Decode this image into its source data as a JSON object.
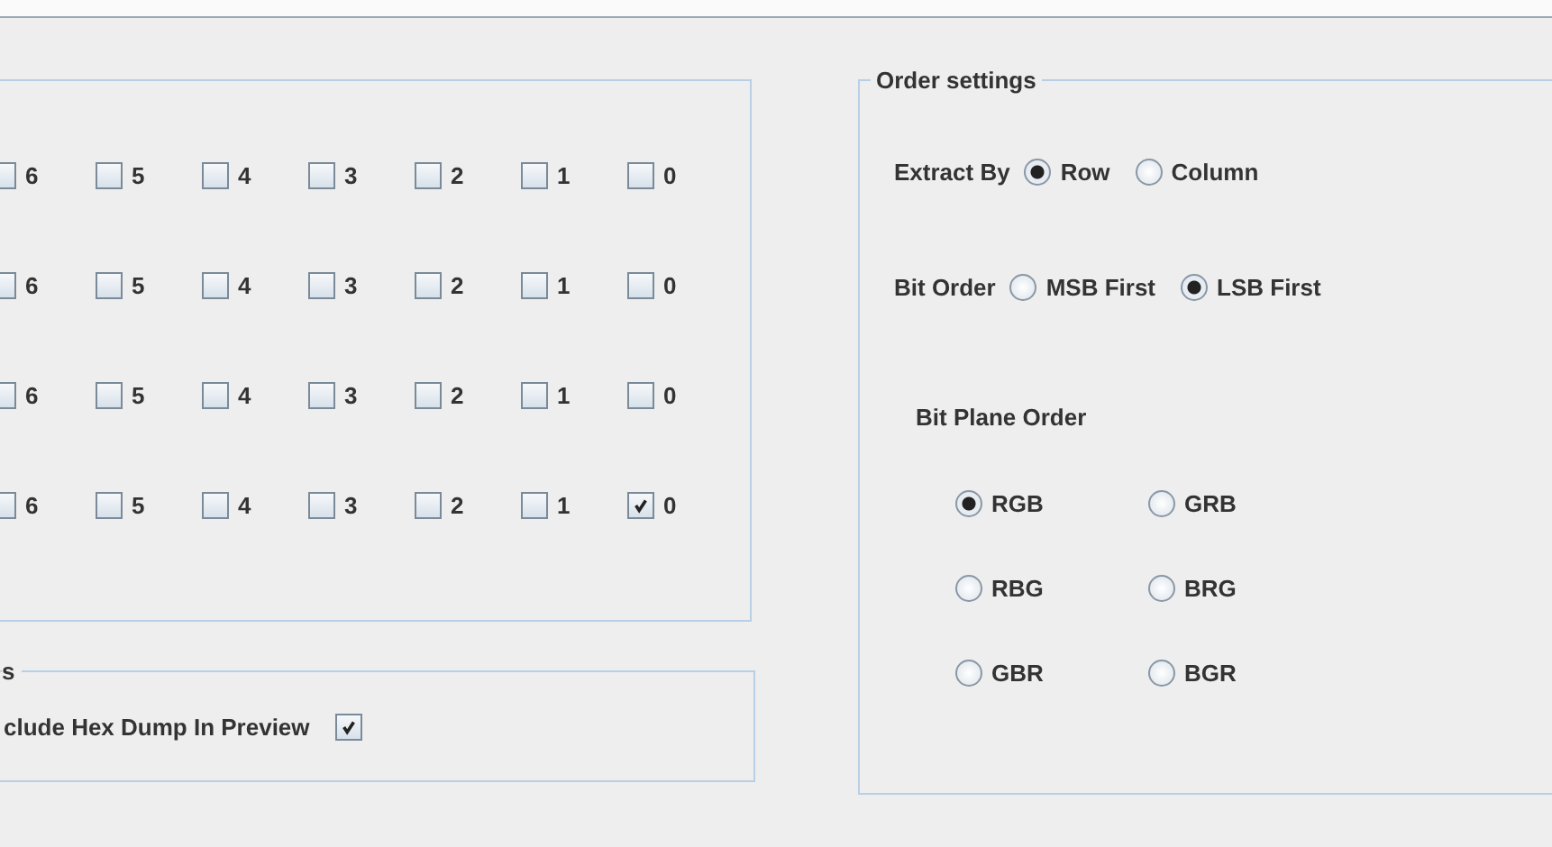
{
  "bit_panel": {
    "rows": [
      {
        "bits": [
          {
            "label": "6",
            "checked": false
          },
          {
            "label": "5",
            "checked": false
          },
          {
            "label": "4",
            "checked": false
          },
          {
            "label": "3",
            "checked": false
          },
          {
            "label": "2",
            "checked": false
          },
          {
            "label": "1",
            "checked": false
          },
          {
            "label": "0",
            "checked": false
          }
        ]
      },
      {
        "bits": [
          {
            "label": "6",
            "checked": false
          },
          {
            "label": "5",
            "checked": false
          },
          {
            "label": "4",
            "checked": false
          },
          {
            "label": "3",
            "checked": false
          },
          {
            "label": "2",
            "checked": false
          },
          {
            "label": "1",
            "checked": false
          },
          {
            "label": "0",
            "checked": false
          }
        ]
      },
      {
        "bits": [
          {
            "label": "6",
            "checked": false
          },
          {
            "label": "5",
            "checked": false
          },
          {
            "label": "4",
            "checked": false
          },
          {
            "label": "3",
            "checked": false
          },
          {
            "label": "2",
            "checked": false
          },
          {
            "label": "1",
            "checked": false
          },
          {
            "label": "0",
            "checked": false
          }
        ]
      },
      {
        "bits": [
          {
            "label": "6",
            "checked": false
          },
          {
            "label": "5",
            "checked": false
          },
          {
            "label": "4",
            "checked": false
          },
          {
            "label": "3",
            "checked": false
          },
          {
            "label": "2",
            "checked": false
          },
          {
            "label": "1",
            "checked": false
          },
          {
            "label": "0",
            "checked": true
          }
        ]
      }
    ]
  },
  "options_panel": {
    "title": "s",
    "option": {
      "label": "clude Hex Dump In Preview",
      "checked": true
    }
  },
  "order_settings": {
    "title": "Order settings",
    "extract_by": {
      "label": "Extract By",
      "options": [
        {
          "label": "Row",
          "selected": true
        },
        {
          "label": "Column",
          "selected": false
        }
      ]
    },
    "bit_order": {
      "label": "Bit Order",
      "options": [
        {
          "label": "MSB First",
          "selected": false
        },
        {
          "label": "LSB First",
          "selected": true
        }
      ]
    },
    "bit_plane_order": {
      "label": "Bit Plane Order",
      "options": [
        {
          "label": "RGB",
          "selected": true
        },
        {
          "label": "GRB",
          "selected": false
        },
        {
          "label": "RBG",
          "selected": false
        },
        {
          "label": "BRG",
          "selected": false
        },
        {
          "label": "GBR",
          "selected": false
        },
        {
          "label": "BGR",
          "selected": false
        }
      ]
    }
  }
}
